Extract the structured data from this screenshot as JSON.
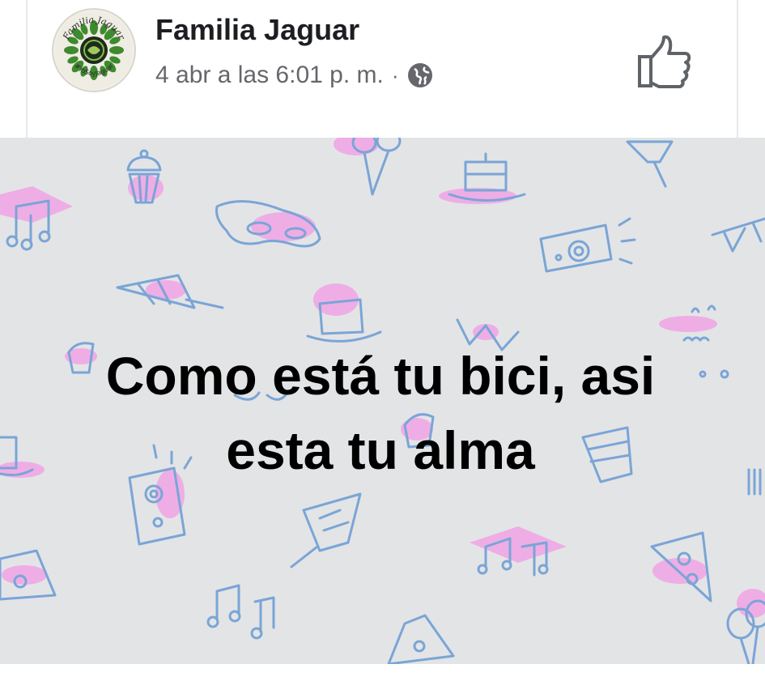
{
  "post": {
    "page_name": "Familia Jaguar",
    "timestamp": "4 abr a las 6:01 p. m.",
    "separator": "·",
    "privacy_icon": "globe-icon",
    "avatar": {
      "top_text": "Familia Jaguar",
      "bottom_text": "#YoSoyJaguar"
    },
    "like_icon": "thumbs-up-icon"
  },
  "status": {
    "line1": "Como está tu bici, asi",
    "line2": "esta tu alma",
    "background_color": "#e3e4e6",
    "doodle_stroke_color": "#7aa5d6",
    "doodle_fill_color": "#f39be6"
  }
}
